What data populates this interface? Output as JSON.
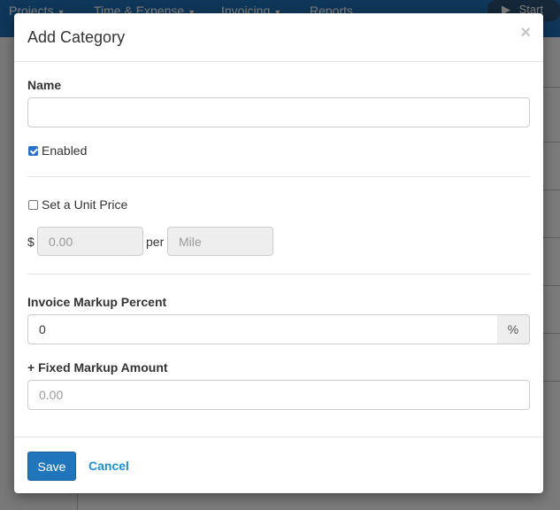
{
  "background": {
    "nav": [
      {
        "label": "Projects"
      },
      {
        "label": "Time & Expense"
      },
      {
        "label": "Invoicing"
      },
      {
        "label": "Reports"
      }
    ],
    "start_label": "Start"
  },
  "modal": {
    "title": "Add Category",
    "close_glyph": "×",
    "name": {
      "label": "Name",
      "value": "",
      "placeholder": ""
    },
    "enabled": {
      "label": "Enabled",
      "checked": true
    },
    "unit_price": {
      "label": "Set a Unit Price",
      "checked": false,
      "currency": "$",
      "price_placeholder": "0.00",
      "per_label": "per",
      "unit_placeholder": "Mile"
    },
    "invoice_markup": {
      "label": "Invoice Markup Percent",
      "value": "0",
      "addon": "%"
    },
    "fixed_markup": {
      "label": "+ Fixed Markup Amount",
      "placeholder": "0.00"
    },
    "footer": {
      "save_label": "Save",
      "cancel_label": "Cancel"
    }
  },
  "colors": {
    "primary": "#2176bb",
    "link": "#1e8fd6",
    "checkbox_checked": "#2a70c9"
  }
}
